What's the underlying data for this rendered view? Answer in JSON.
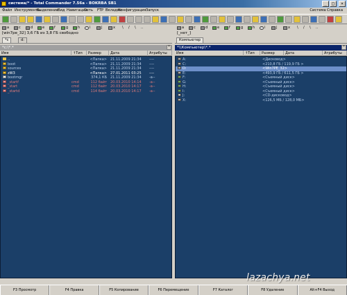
{
  "window": {
    "title": "система/* - Total Commander 7.56a - BOKRBA SB1"
  },
  "menu": {
    "items": [
      "Файл",
      "Инструменты",
      "Выделение",
      "Вид",
      "Навигация",
      "Сеть",
      "FTP",
      "Вкладки",
      "Конфигурация",
      "Запуск"
    ],
    "right": "Система   Справка"
  },
  "drives_left": [
    "a",
    "c",
    "d",
    "e",
    "f",
    "g",
    "h",
    "i",
    "j",
    "x"
  ],
  "drives_right": [
    "a",
    "c",
    "d",
    "e",
    "f",
    "g",
    "h",
    "i",
    "j",
    "x"
  ],
  "left": {
    "info": "[win7pe_32]  3,6 ГБ из 3,8 ГБ свободно",
    "tabs": [
      "*c",
      "d:"
    ],
    "path": "*c:\\*.*",
    "columns": [
      "Имя",
      "↑Тип",
      "Размер",
      "Дата",
      "Атрибуты"
    ],
    "rows": [
      {
        "name": "..",
        "type": "",
        "size": "<Папка>",
        "date": "21.11.2009 21:34",
        "attr": "----",
        "icon": "up",
        "style": ""
      },
      {
        "name": "boot",
        "type": "",
        "size": "<Папка>",
        "date": "21.11.2009 21:34",
        "attr": "----",
        "icon": "folder",
        "style": ""
      },
      {
        "name": "sources",
        "type": "",
        "size": "<Папка>",
        "date": "21.11.2009 21:34",
        "attr": "----",
        "icon": "folder",
        "style": ""
      },
      {
        "name": "zW3",
        "type": "",
        "size": "<Папка>",
        "date": "27.01.2011 03:25",
        "attr": "----",
        "icon": "folder",
        "style": "white"
      },
      {
        "name": "bootmgr",
        "type": "",
        "size": "374,1 КБ",
        "date": "21.11.2009 21:34",
        "attr": "-a--",
        "icon": "file",
        "style": ""
      },
      {
        "name": "_startf",
        "type": "cmd",
        "size": "112 байт",
        "date": "20.03.2010 14:14",
        "attr": "-a--",
        "icon": "cmd",
        "style": "red"
      },
      {
        "name": "_start",
        "type": "cmd",
        "size": "112 байт",
        "date": "20.03.2010 14:17",
        "attr": "-a--",
        "icon": "cmd",
        "style": "red"
      },
      {
        "name": "_startd",
        "type": "cmd",
        "size": "114 байт",
        "date": "20.03.2010 14:17",
        "attr": "-a--",
        "icon": "cmd",
        "style": "red"
      }
    ]
  },
  "right": {
    "info": "[_нет_]",
    "tabs": [
      "Компьютер"
    ],
    "path": "*\\\\Компьютер\\*.*",
    "columns": [
      "Имя",
      "↑Тип",
      "Размер",
      "Дата",
      "Атрибуты"
    ],
    "rows": [
      {
        "name": "A:",
        "size": "<Дисковод>",
        "icon": "drive",
        "cursor": false
      },
      {
        "name": "C:",
        "size": "<210,8 ГБ / 119,9 ГБ >",
        "icon": "drive",
        "cursor": false
      },
      {
        "name": "D:",
        "size": "<Win7PE_32>",
        "icon": "drive",
        "cursor": true
      },
      {
        "name": "E:",
        "size": "<493,9 ГБ / 611,5 ГБ >",
        "icon": "drive",
        "cursor": false
      },
      {
        "name": "F:",
        "size": "<Съемный диск>",
        "icon": "drive g",
        "cursor": false
      },
      {
        "name": "G:",
        "size": "<Съемный диск>",
        "icon": "drive g",
        "cursor": false
      },
      {
        "name": "H:",
        "size": "<Съемный диск>",
        "icon": "drive g",
        "cursor": false
      },
      {
        "name": "I:",
        "size": "<Съемный диск>",
        "icon": "drive g",
        "cursor": false
      },
      {
        "name": "J:",
        "size": "<CD-дисковод>",
        "icon": "drive cd",
        "cursor": false
      },
      {
        "name": "X:",
        "size": "<126,5 МБ / 128,0 МБ>",
        "icon": "drive",
        "cursor": false
      }
    ]
  },
  "fkeys": [
    "F3 Просмотр",
    "F4 Правка",
    "F5 Копирование",
    "F6 Перемещение",
    "F7 Каталог",
    "F8 Удаление",
    "Alt+F4 Выход"
  ],
  "watermark": "lazachya.net"
}
